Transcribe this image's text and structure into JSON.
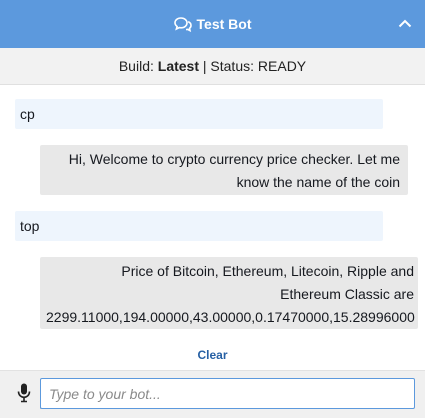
{
  "header": {
    "title": "Test Bot",
    "chat_icon": "chat-bubbles-icon",
    "collapse_icon": "chevron-up-icon",
    "background_color": "#5c99dd"
  },
  "status_bar": {
    "build_label": "Build:",
    "build_value": "Latest",
    "separator": "|",
    "status_label": "Status:",
    "status_value": "READY"
  },
  "conversation": {
    "messages": [
      {
        "sender": "user",
        "lines": [
          "cp"
        ]
      },
      {
        "sender": "bot",
        "lines": [
          "Hi, Welcome to crypto currency price checker. Let me",
          "know the name of the coin"
        ]
      },
      {
        "sender": "user",
        "lines": [
          "top"
        ]
      },
      {
        "sender": "bot",
        "lines": [
          "Price of Bitcoin, Ethereum, Litecoin, Ripple and",
          "Ethereum Classic are",
          "2299.11000,194.00000,43.00000,0.17470000,15.28996000"
        ]
      }
    ],
    "user_bubble_color": "#eef5fd",
    "bot_bubble_color": "#e8e8e8"
  },
  "clear": {
    "label": "Clear"
  },
  "input": {
    "placeholder": "Type to your bot...",
    "value": "",
    "mic_icon": "microphone-icon"
  }
}
